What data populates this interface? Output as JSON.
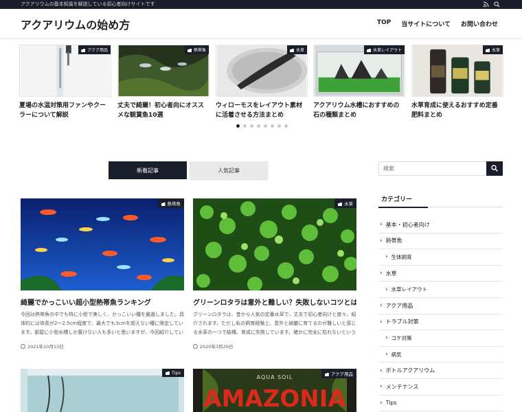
{
  "topbar": {
    "tagline": "アクアリウムの基本知識を解説している初心者向けサイトです"
  },
  "header": {
    "logo": "アクアリウムの始め方",
    "nav": [
      {
        "label": "TOP"
      },
      {
        "label": "当サイトについて"
      },
      {
        "label": "お問い合わせ"
      }
    ]
  },
  "slider": {
    "slides": [
      {
        "category": "アクア用品",
        "title": "夏場の水温対策用ファンやクーラーについて解説"
      },
      {
        "category": "熱帯魚",
        "title": "丈夫で綺麗！初心者向にオススメな観賞魚10選"
      },
      {
        "category": "水草",
        "title": "ウィローモスをレイアウト素材に活着させる方法まとめ"
      },
      {
        "category": "水草レイアウト",
        "title": "アクアリウム水槽におすすめの石の種類まとめ"
      },
      {
        "category": "水草",
        "title": "水草育成に使えるおすすめ定番肥料まとめ"
      }
    ],
    "dot_count": 8,
    "active_dot": 0
  },
  "tabs": {
    "active": "新着記事",
    "inactive": "人気記事"
  },
  "cards": [
    {
      "category": "熱帯魚",
      "title": "綺麗でかっこいい超小型熱帯魚ランキング",
      "excerpt": "今回は熱帯魚の中でも特に小型で美しく、かっこいい種を厳選しました。具体的には体長が2～2.5cm程度で、最大でも3cmを超えない種に限定しています。部屋に小型水槽しか置けない人も多いと思いますが、今回紹介している人気熱帯魚はどれも小型水槽向きな...",
      "date": "2021年10月13日"
    },
    {
      "category": "水草",
      "title": "グリーンロタラは意外と難しい？失敗しないコツとは",
      "excerpt": "グリーンロタラは、昔から人気の定番水草で、丈夫で初心者向けと度々、紹介されます。ただし私の飼育経験上、意外と綺麗に育てるのが難しいと感じる水草の一つで結構、育成に失敗しています。確かに完全に枯れないという意味では丈夫なのですが、森...",
      "date": "2020年3月29日"
    },
    {
      "category": "Tips",
      "title": "",
      "excerpt": "",
      "date": ""
    },
    {
      "category": "アクア用品",
      "title": "",
      "excerpt": "",
      "date": "",
      "image_text_1": "AQUA SOIL",
      "image_text_2": "AMAZONIA"
    }
  ],
  "sidebar": {
    "search_placeholder": "検索",
    "category_heading": "カテゴリー",
    "categories": [
      {
        "label": "基本・初心者向け",
        "level": 1
      },
      {
        "label": "熱帯魚",
        "level": 1
      },
      {
        "label": "生体飼育",
        "level": 2
      },
      {
        "label": "水草",
        "level": 1
      },
      {
        "label": "水草レイアウト",
        "level": 2
      },
      {
        "label": "アクア用品",
        "level": 1
      },
      {
        "label": "トラブル対策",
        "level": 1
      },
      {
        "label": "コケ対策",
        "level": 2
      },
      {
        "label": "病気",
        "level": 2
      },
      {
        "label": "ボトルアクアリウム",
        "level": 1
      },
      {
        "label": "メンテナンス",
        "level": 1
      },
      {
        "label": "Tips",
        "level": 1
      }
    ]
  },
  "colors": {
    "dark": "#1a1d2a",
    "accent_green": "#3cae3c"
  }
}
